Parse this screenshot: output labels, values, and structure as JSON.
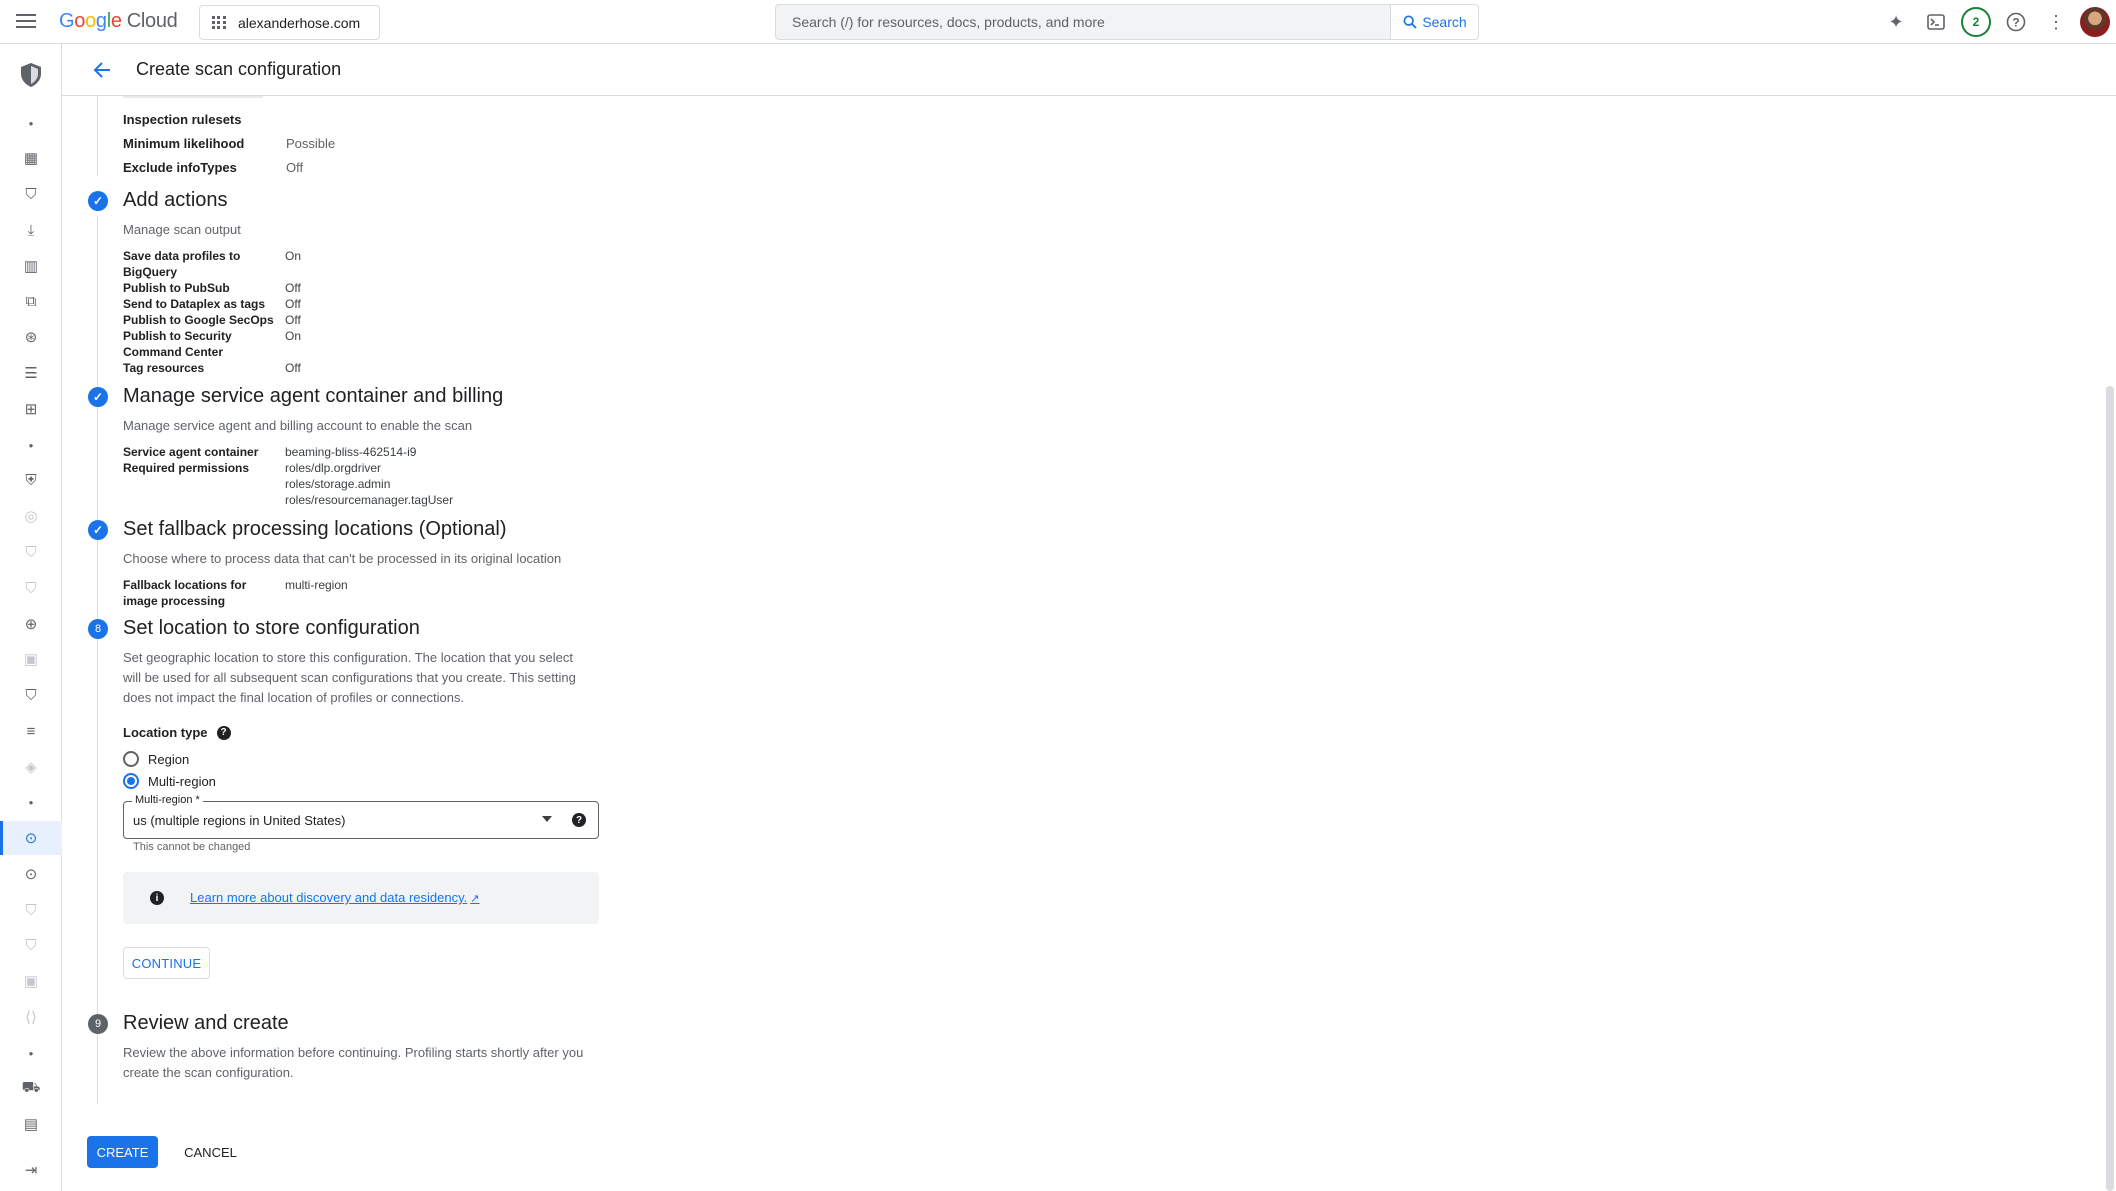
{
  "topbar": {
    "logo_letters": [
      "G",
      "o",
      "o",
      "g",
      "l",
      "e"
    ],
    "logo_product": "Cloud",
    "project": "alexanderhose.com",
    "search_placeholder": "Search (/) for resources, docs, products, and more",
    "search_button": "Search",
    "notification_count": "2"
  },
  "header": {
    "title": "Create scan configuration"
  },
  "partial_top": {
    "items": [
      {
        "key": "Inspection rulesets",
        "value": ""
      },
      {
        "key": "Minimum likelihood",
        "value": "Possible"
      },
      {
        "key": "Exclude infoTypes",
        "value": "Off"
      }
    ]
  },
  "steps": {
    "actions": {
      "title": "Add actions",
      "desc": "Manage scan output",
      "items": [
        {
          "key": "Save data profiles to",
          "value": "On"
        },
        {
          "key": "BigQuery",
          "value": ""
        },
        {
          "key": "Publish to PubSub",
          "value": "Off"
        },
        {
          "key": "Send to Dataplex as tags",
          "value": "Off"
        },
        {
          "key": "Publish to Google SecOps",
          "value": "Off"
        },
        {
          "key": "Publish to Security",
          "value": "On"
        },
        {
          "key": "Command Center",
          "value": ""
        },
        {
          "key": "Tag resources",
          "value": "Off"
        }
      ]
    },
    "service_agent": {
      "title": "Manage service agent container and billing",
      "desc": "Manage service agent and billing account to enable the scan",
      "container_label": "Service agent container",
      "container_value": "beaming-bliss-462514-i9",
      "permissions_label": "Required permissions",
      "permissions": [
        "roles/dlp.orgdriver",
        "roles/storage.admin",
        "roles/resourcemanager.tagUser"
      ]
    },
    "fallback": {
      "title": "Set fallback processing locations (Optional)",
      "desc": "Choose where to process data that can't be processed in its original location",
      "label_line1": "Fallback locations for",
      "label_line2": "image processing",
      "value": "multi-region"
    },
    "location": {
      "number": "8",
      "title": "Set location to store configuration",
      "desc_lines": [
        "Set geographic location to store this configuration. The location that you select",
        "will be used for all subsequent scan configurations that you create. This setting",
        "does not impact the final location of profiles or connections."
      ],
      "location_type_label": "Location type",
      "options": [
        "Region",
        "Multi-region"
      ],
      "selected_option": "Multi-region",
      "select_label": "Multi-region *",
      "select_value": "us (multiple regions in United States)",
      "hint": "This cannot be changed",
      "info_link": "Learn more about discovery and data residency.",
      "continue_label": "CONTINUE"
    },
    "review": {
      "number": "9",
      "title": "Review and create",
      "desc_lines": [
        "Review the above information before continuing. Profiling starts shortly after you",
        "create the scan configuration."
      ]
    }
  },
  "footer": {
    "create_label": "CREATE",
    "cancel_label": "CANCEL"
  },
  "colors": {
    "accent": "#1a73e8",
    "success": "#188038",
    "text": "#202124",
    "muted": "#5f6368"
  },
  "rail_icons": [
    "security-shield-icon",
    "dot-icon",
    "dashboard-icon",
    "shield-icon",
    "download-icon",
    "chart-icon",
    "network-icon",
    "search-shield-icon",
    "list-icon",
    "grid-icon",
    "dot-icon",
    "badge-icon",
    "faded-icon",
    "faded-icon",
    "faded-icon",
    "globe-icon",
    "id-icon",
    "shield-icon",
    "search-list-icon",
    "speaker-icon",
    "dot-icon",
    "dlp-active-icon",
    "dlp-icon",
    "shield-icon",
    "faded-icon",
    "faded-icon",
    "code-icon",
    "dot-icon",
    "cart-icon",
    "report-icon",
    "expand-icon"
  ]
}
